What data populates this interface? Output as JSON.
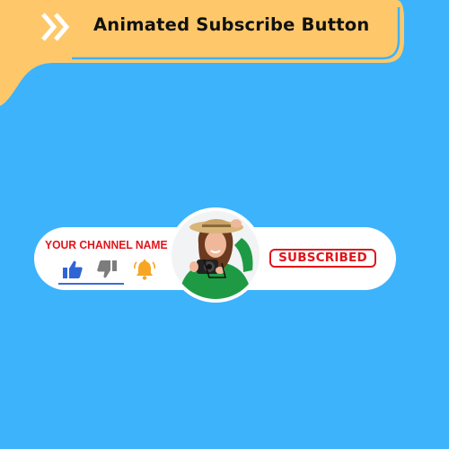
{
  "banner": {
    "title": "Animated Subscribe Button",
    "icon": "double-chevron-right-icon",
    "color": "#fec86a"
  },
  "background_color": "#3db3fb",
  "widget": {
    "channel_name": "YOUR CHANNEL NAME",
    "subscribe_label": "SUBSCRIBED",
    "accent_color": "#e0151b",
    "icons": [
      "thumbs-up-icon",
      "thumbs-down-icon",
      "bell-icon"
    ],
    "avatar": "person-with-camera-photo"
  }
}
